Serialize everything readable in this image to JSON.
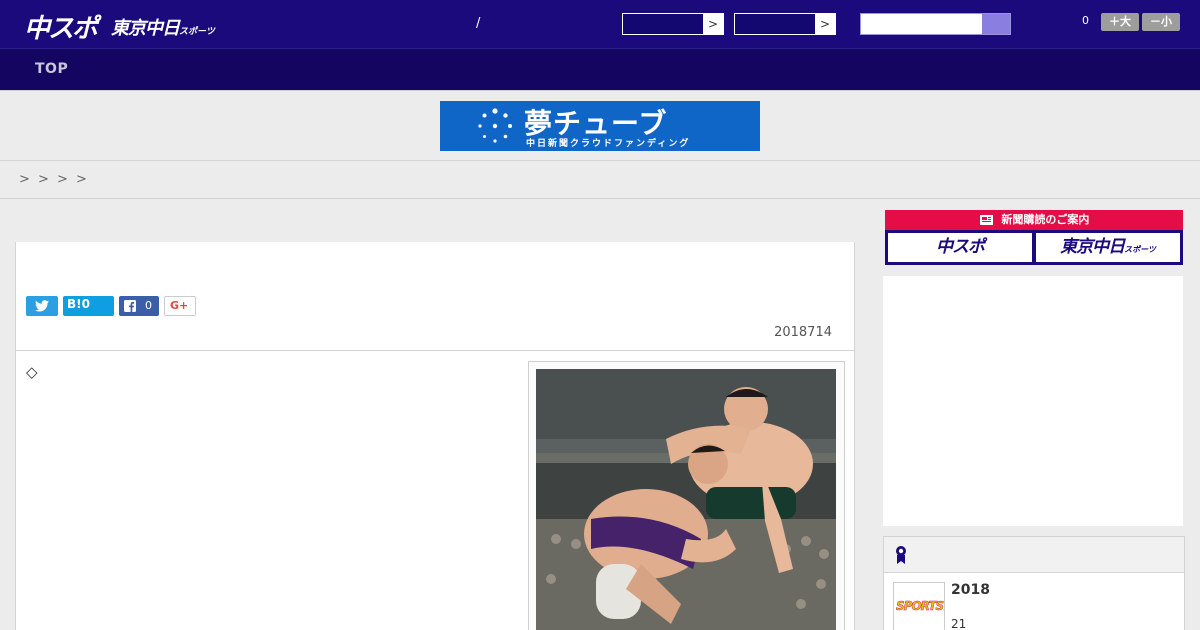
{
  "header": {
    "logo_main": "中スポ",
    "logo_secondary": "東京中日",
    "logo_secondary_small": "スポーツ",
    "separator": "/",
    "select_arrow": ">",
    "search": {
      "value": "",
      "placeholder": ""
    },
    "font_size": {
      "count": "0",
      "larger_label": "＋大",
      "smaller_label": "－小"
    }
  },
  "nav": {
    "items": [
      {
        "label": "TOP"
      }
    ]
  },
  "banner": {
    "title": "夢チューブ",
    "subtitle": "中日新聞クラウドファンディング"
  },
  "breadcrumb": {
    "items": [
      ">",
      ">",
      ">",
      ">"
    ]
  },
  "article": {
    "share": {
      "twitter": "",
      "hatena": "B!0",
      "facebook_count": "0",
      "gplus": "G+"
    },
    "date": "2018714",
    "body_mark": "◇"
  },
  "sidebar": {
    "subscription": {
      "heading": "新聞購読のご案内",
      "left_logo": "中スポ",
      "right_logo": "東京中日",
      "right_logo_small": "スポーツ"
    },
    "ranking": {
      "thumb_text": "SPORTS!!",
      "year": "2018",
      "number": "21"
    }
  },
  "colors": {
    "header_bg": "#1a0a7c",
    "nav_bg": "#140660",
    "accent_red": "#e0242e",
    "accent_purple": "#7a62c8",
    "subscribe_red": "#e40d48",
    "banner_blue": "#1066c7",
    "twitter": "#2a9fe2",
    "facebook": "#3b5ea8"
  },
  "icons": [
    "twitter-icon",
    "hatena-icon",
    "facebook-icon",
    "gplus-icon",
    "newspaper-icon",
    "ranking-medal-icon"
  ]
}
